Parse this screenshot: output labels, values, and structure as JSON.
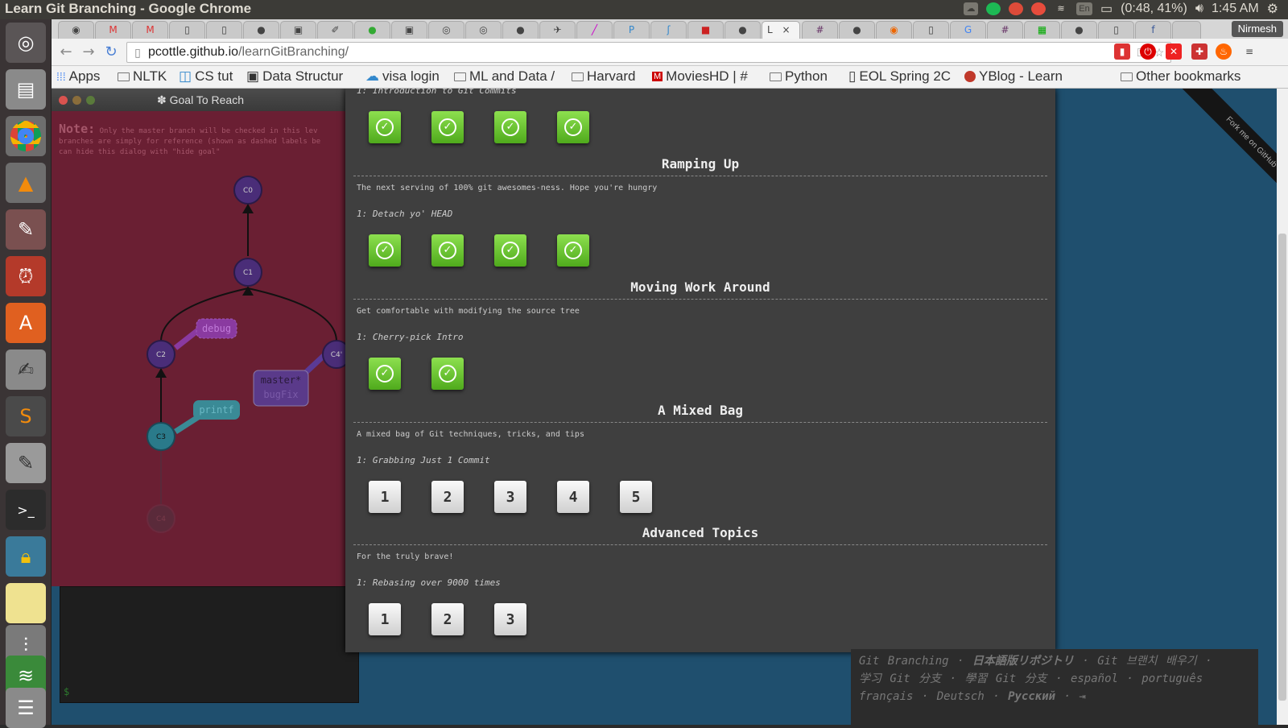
{
  "os": {
    "window_title": "Learn Git Branching - Google Chrome",
    "battery": "(0:48, 41%)",
    "clock": "1:45 AM",
    "keyboard": "En"
  },
  "browser": {
    "user": "Nirmesh",
    "active_tab": "L",
    "tab_close": "×",
    "url_host": "pcottle.github.io",
    "url_path": "/learnGitBranching/",
    "bookmarks": [
      "Apps",
      "NLTK",
      "CS tut",
      "Data Structur",
      "visa login",
      "ML and Data /",
      "Harvard",
      "MoviesHD | #",
      "Python",
      "EOL Spring 2C",
      "YBlog - Learn"
    ],
    "other_bookmarks": "Other bookmarks"
  },
  "goal": {
    "header": "✽ Goal To Reach",
    "note_label": "Note:",
    "note_lines": [
      "Only the master branch will be checked in this lev",
      "branches are simply for reference (shown as dashed labels be",
      "can hide this dialog with \"hide goal\""
    ],
    "commits": [
      "C0",
      "C1",
      "C2",
      "C3",
      "C4'",
      "C4"
    ],
    "branches": {
      "debug": "debug",
      "printf": "printf",
      "master": "master*",
      "bugfix": "bugFix"
    }
  },
  "terminal": {
    "prompt": "$"
  },
  "fork": "Fork me on GitHub",
  "sections": [
    {
      "title": "",
      "about": "",
      "sequence": "1: Introduction to Git Commits",
      "levels": [
        "done",
        "done",
        "done",
        "done"
      ]
    },
    {
      "title": "Ramping Up",
      "about": "The next serving of 100% git awesomes-ness. Hope you're hungry",
      "sequence": "1: Detach yo' HEAD",
      "levels": [
        "done",
        "done",
        "done",
        "done"
      ]
    },
    {
      "title": "Moving Work Around",
      "about": "Get comfortable with modifying the source tree",
      "sequence": "1: Cherry-pick Intro",
      "levels": [
        "done",
        "done"
      ]
    },
    {
      "title": "A Mixed Bag",
      "about": "A mixed bag of Git techniques, tricks, and tips",
      "sequence": "1: Grabbing Just 1 Commit",
      "levels": [
        "1",
        "2",
        "3",
        "4",
        "5"
      ]
    },
    {
      "title": "Advanced Topics",
      "about": "For the truly brave!",
      "sequence": "1: Rebasing over 9000 times",
      "levels": [
        "1",
        "2",
        "3"
      ]
    }
  ],
  "languages": {
    "line1": [
      "Git Branching",
      "日本語版リポジトリ",
      "Git 브랜치 배우기"
    ],
    "line2": [
      "学习 Git 分支",
      "學習 Git 分支",
      "español",
      "português"
    ],
    "line3": [
      "français",
      "Deutsch",
      "Русский"
    ],
    "sep": "·",
    "exit_icon": "⇥"
  },
  "colors": {
    "goal_bg": "#6a1f33",
    "page_bg": "#1f4f6e",
    "done_green": "#5fbf2a",
    "commit_purple": "#4a2d78"
  },
  "icons": [
    "ubuntu-icon",
    "files-icon",
    "chrome-icon",
    "vlc-icon",
    "settings-icon",
    "alarm-icon",
    "software-center-icon",
    "text-editor-icon",
    "sublime-icon",
    "notes-icon",
    "terminal-icon",
    "lock-icon",
    "sticky-notes-icon",
    "mixer-icon",
    "spotify-icon",
    "disk-icon"
  ]
}
